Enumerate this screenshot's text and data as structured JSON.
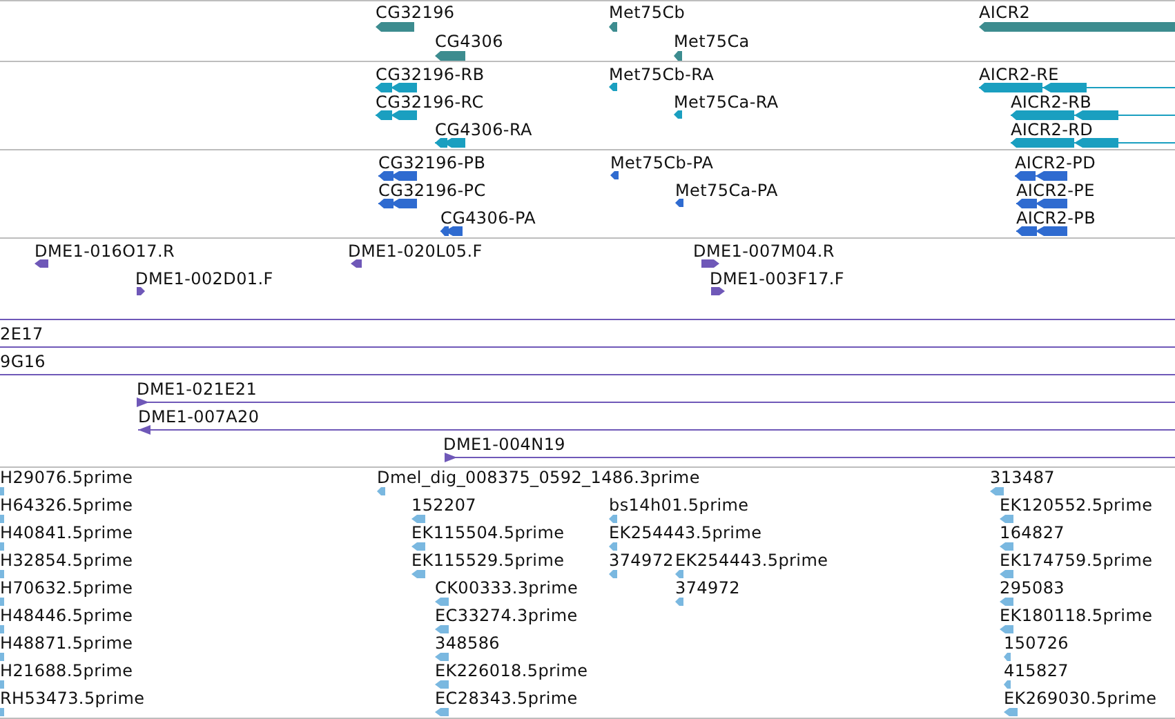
{
  "tracks": [
    {
      "kind": "gene",
      "color": "#3d8c8f",
      "features": [
        {
          "label": "CG32196",
          "reverse": true
        },
        {
          "label": "Met75Cb",
          "reverse": true
        },
        {
          "label": "AICR2",
          "reverse": true
        },
        {
          "label": "CG4306",
          "reverse": true
        },
        {
          "label": "Met75Ca",
          "reverse": true
        }
      ]
    },
    {
      "kind": "transcript",
      "color": "#1a9fc0",
      "features": [
        {
          "label": "CG32196-RB",
          "reverse": true
        },
        {
          "label": "Met75Cb-RA",
          "reverse": true
        },
        {
          "label": "AICR2-RE",
          "reverse": true
        },
        {
          "label": "CG32196-RC",
          "reverse": true
        },
        {
          "label": "Met75Ca-RA",
          "reverse": true
        },
        {
          "label": "AICR2-RB",
          "reverse": true
        },
        {
          "label": "CG4306-RA",
          "reverse": true
        },
        {
          "label": "AICR2-RD",
          "reverse": true
        }
      ]
    },
    {
      "kind": "protein",
      "color": "#2f6bd0",
      "features": [
        {
          "label": "CG32196-PB",
          "reverse": true
        },
        {
          "label": "Met75Cb-PA",
          "reverse": true
        },
        {
          "label": "AICR2-PD",
          "reverse": true
        },
        {
          "label": "CG32196-PC",
          "reverse": true
        },
        {
          "label": "Met75Ca-PA",
          "reverse": true
        },
        {
          "label": "AICR2-PE",
          "reverse": true
        },
        {
          "label": "CG4306-PA",
          "reverse": true
        },
        {
          "label": "AICR2-PB",
          "reverse": true
        }
      ]
    },
    {
      "kind": "clone",
      "color": "#6f58b8",
      "features": [
        {
          "label": "DME1-016O17.R",
          "reverse": true
        },
        {
          "label": "DME1-020L05.F",
          "reverse": true
        },
        {
          "label": "DME1-007M04.R",
          "reverse": false
        },
        {
          "label": "DME1-002D01.F",
          "reverse": false
        },
        {
          "label": "DME1-003F17.F",
          "reverse": false
        },
        {
          "cut": true
        },
        {
          "label": "2E17",
          "cut": true
        },
        {
          "label": "9G16",
          "cut": true
        },
        {
          "label": "DME1-021E21",
          "reverse": false
        },
        {
          "label": "DME1-007A20",
          "reverse": true
        },
        {
          "label": "DME1-004N19",
          "reverse": false
        }
      ]
    },
    {
      "kind": "est",
      "color": "#7ab8e0",
      "features": [
        {
          "label": "H29076.5prime"
        },
        {
          "label": "Dmel_dig_008375_0592_1486.3prime",
          "reverse": true
        },
        {
          "label": "313487",
          "reverse": true
        },
        {
          "label": "H64326.5prime"
        },
        {
          "label": "152207",
          "reverse": true
        },
        {
          "label": "bs14h01.5prime",
          "reverse": true
        },
        {
          "label": "EK120552.5prime",
          "reverse": true
        },
        {
          "label": "H40841.5prime"
        },
        {
          "label": "EK115504.5prime",
          "reverse": true
        },
        {
          "label": "EK254443.5prime",
          "reverse": true
        },
        {
          "label": "164827",
          "reverse": true
        },
        {
          "label": "H32854.5prime"
        },
        {
          "label": "EK115529.5prime",
          "reverse": true
        },
        {
          "label": "374972",
          "reverse": true
        },
        {
          "label": "EK254443.5prime",
          "reverse": true
        },
        {
          "label": "EK174759.5prime",
          "reverse": true
        },
        {
          "label": "H70632.5prime"
        },
        {
          "label": "CK00333.3prime",
          "reverse": true
        },
        {
          "label": "374972",
          "reverse": true
        },
        {
          "label": "295083",
          "reverse": true
        },
        {
          "label": "H48446.5prime"
        },
        {
          "label": "EC33274.3prime",
          "reverse": true
        },
        {
          "label": "EK180118.5prime",
          "reverse": true
        },
        {
          "label": "H48871.5prime"
        },
        {
          "label": "348586",
          "reverse": true
        },
        {
          "label": "150726",
          "reverse": true
        },
        {
          "label": "H21688.5prime"
        },
        {
          "label": "EK226018.5prime",
          "reverse": true
        },
        {
          "label": "415827",
          "reverse": true
        },
        {
          "label": "RH53473.5prime"
        },
        {
          "label": "EC28343.5prime",
          "reverse": true
        },
        {
          "label": "EK269030.5prime",
          "reverse": true
        }
      ]
    }
  ]
}
